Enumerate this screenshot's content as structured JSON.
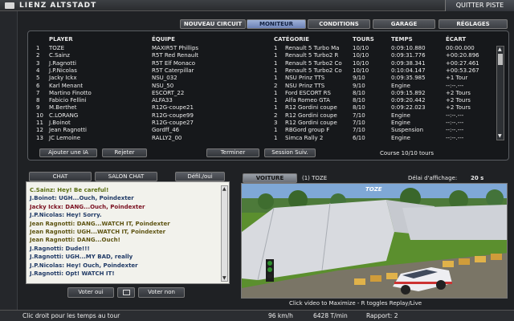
{
  "app": {
    "title": "LIENZ ALTSTADT",
    "quit_label": "QUITTER PISTE"
  },
  "tabs": [
    "NOUVEAU CIRCUIT",
    "MONITEUR",
    "CONDITIONS",
    "GARAGE",
    "RÉGLAGES"
  ],
  "results": {
    "columns": [
      "PLAYER",
      "ÉQUIPE",
      "CATÉGORIE",
      "TOURS",
      "TEMPS",
      "ÉCART"
    ],
    "rows": [
      [
        "1",
        "TOZE",
        "MAXIR5T Phillips",
        "1",
        "Renault 5 Turbo Ma",
        "10/10",
        "0:09:10.880",
        "00:00.000"
      ],
      [
        "2",
        "C.Sainz",
        "R5T Red Renault",
        "1",
        "Renault 5 Turbo2 R",
        "10/10",
        "0:09:31.776",
        "+00:20.896"
      ],
      [
        "3",
        "J.Ragnotti",
        "R5T Elf Monaco",
        "1",
        "Renault 5 Turbo2 Co",
        "10/10",
        "0:09:38.341",
        "+00:27.461"
      ],
      [
        "4",
        "J.P.Nicolas",
        "R5T Caterpillar",
        "1",
        "Renault 5 Turbo2 Co",
        "10/10",
        "0:10:04.147",
        "+00:53.267"
      ],
      [
        "5",
        "Jacky Ickx",
        "NSU_032",
        "1",
        "NSU Prinz TTS",
        "9/10",
        "0:09:35.985",
        "+1 Tour"
      ],
      [
        "6",
        "Karl Menant",
        "NSU_50",
        "2",
        "NSU Prinz TTS",
        "9/10",
        "Engine",
        "--:--.---"
      ],
      [
        "7",
        "Martino Finotto",
        "ESCORT_22",
        "1",
        "Ford ESCORT RS",
        "8/10",
        "0:09:15.892",
        "+2 Tours"
      ],
      [
        "8",
        "Fabicio Fellini",
        "ALFA33",
        "1",
        "Alfa Romeo GTA",
        "8/10",
        "0:09:20.442",
        "+2 Tours"
      ],
      [
        "9",
        "M.Berthet",
        "R12G-coupe21",
        "1",
        "R12 Gordini coupe",
        "8/10",
        "0:09:22.023",
        "+2 Tours"
      ],
      [
        "10",
        "C.LORANG",
        "R12G-coupe99",
        "2",
        "R12 Gordini coupe",
        "7/10",
        "Engine",
        "--:--.---"
      ],
      [
        "11",
        "J.Boinot",
        "R12G-coupe27",
        "3",
        "R12 Gordini coupe",
        "7/10",
        "Engine",
        "--:--.---"
      ],
      [
        "12",
        "Jean Ragnotti",
        "Gordff_46",
        "1",
        "RBGord group F",
        "7/10",
        "Suspension",
        "--:--.---"
      ],
      [
        "13",
        "JC Lemoine",
        "RALLY2_00",
        "1",
        "Simca Rally 2",
        "6/10",
        "Engine",
        "--:--.---"
      ]
    ],
    "buttons": {
      "add_ai": "Ajouter une IA",
      "reject": "Rejeter",
      "finish": "Terminer",
      "next_session": "Session Suiv."
    },
    "race_status": "Course  10/10 tours"
  },
  "chat": {
    "tab_chat": "CHAT",
    "tab_salon": "SALON CHAT",
    "scroll_label": "Défil./oui",
    "lines": [
      {
        "text": "C.Sainz: Hey! Be careful!",
        "color": "#5a6e12"
      },
      {
        "text": "J.Boinot: UGH...Ouch, Poindexter",
        "color": "#203a66"
      },
      {
        "text": "Jacky Ickx: DANG...Ouch, Poindexter",
        "color": "#7a1020"
      },
      {
        "text": "J.P.Nicolas: Hey! Sorry.",
        "color": "#203a66"
      },
      {
        "text": "Jean Ragnotti: DANG...WATCH IT, Poindexter",
        "color": "#5e5412"
      },
      {
        "text": "Jean Ragnotti: UGH...WATCH IT, Poindexter",
        "color": "#5e5412"
      },
      {
        "text": "Jean Ragnotti: DANG...Ouch!",
        "color": "#5e5412"
      },
      {
        "text": "J.Ragnotti: Dude!!!",
        "color": "#203a66"
      },
      {
        "text": "J.Ragnotti: UGH...MY BAD, really",
        "color": "#203a66"
      },
      {
        "text": "J.P.Nicolas: Hey! Ouch, Poindexter",
        "color": "#203a66"
      },
      {
        "text": "J.Ragnotti: Opt! WATCH IT!",
        "color": "#203a66"
      }
    ],
    "vote_yes": "Voter oui",
    "vote_no": "Voter non"
  },
  "video": {
    "mode": "VOITURE",
    "car_label": "(1) TOZE",
    "delay_label": "Délai d'affichage:",
    "delay_value": "20 s",
    "car_tag": "TOZE",
    "hint": "Click video to Maximize  -  R toggles Replay/Live"
  },
  "status": {
    "help": "Clic droit pour les temps au tour",
    "speed": "96 km/h",
    "rpm": "6428 T/min",
    "gear": "Rapport: 2"
  },
  "colors": {
    "accent": "#6c82b6",
    "panel": "#16181b",
    "sky": "#7fa8d6",
    "grass": "#4c7a2a"
  }
}
